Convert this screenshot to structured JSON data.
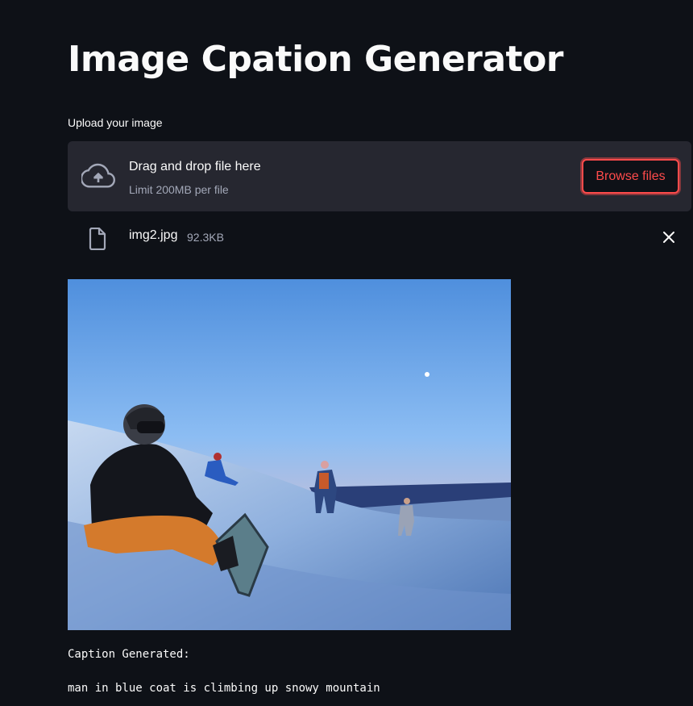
{
  "page": {
    "title": "Image Cpation Generator"
  },
  "uploader": {
    "label": "Upload your image",
    "drop_text": "Drag and drop file here",
    "limit_text": "Limit 200MB per file",
    "browse_label": "Browse files",
    "icon": "cloud-upload-icon"
  },
  "uploaded_file": {
    "name": "img2.jpg",
    "size": "92.3KB",
    "icon": "file-icon",
    "remove_icon": "close-icon"
  },
  "image": {
    "description_icon": "uploaded-photo"
  },
  "result": {
    "label": "Caption Generated:",
    "caption": "man in blue coat is climbing up snowy mountain"
  },
  "colors": {
    "background": "#0e1117",
    "panel": "#262730",
    "accent": "#ff4b4b",
    "text": "#fafafa",
    "muted": "#a3a8b8"
  }
}
